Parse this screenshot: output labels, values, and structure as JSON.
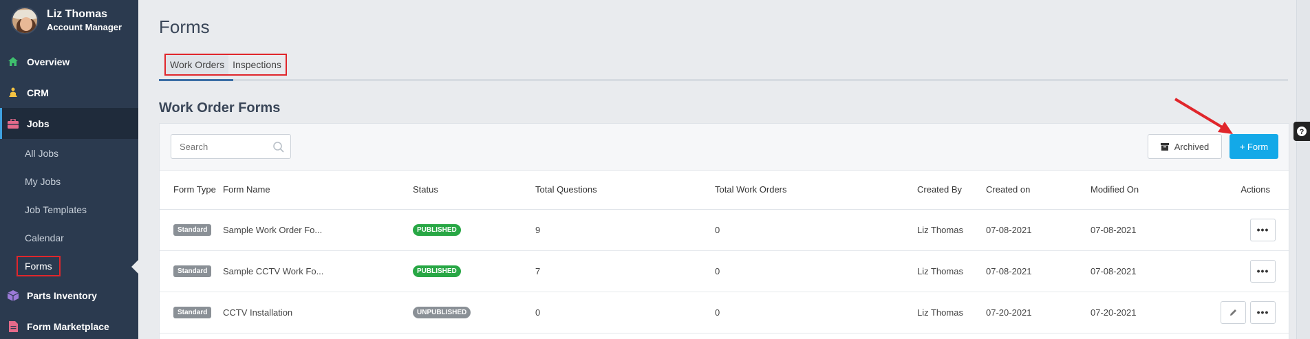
{
  "user": {
    "name": "Liz Thomas",
    "role": "Account Manager"
  },
  "nav": {
    "overview": "Overview",
    "crm": "CRM",
    "jobs": "Jobs",
    "sub": [
      "All Jobs",
      "My Jobs",
      "Job Templates",
      "Calendar",
      "Forms"
    ],
    "parts": "Parts Inventory",
    "marketplace": "Form Marketplace"
  },
  "page": {
    "title": "Forms"
  },
  "tabs": [
    "Work Orders",
    "Inspections"
  ],
  "section": {
    "title": "Work Order Forms"
  },
  "toolbar": {
    "search_placeholder": "Search",
    "archived_label": "Archived",
    "add_form_label": "+ Form"
  },
  "table": {
    "headers": [
      "Form Type",
      "Form Name",
      "Status",
      "Total Questions",
      "Total Work Orders",
      "Created By",
      "Created on",
      "Modified On",
      "Actions"
    ],
    "rows": [
      {
        "type": "Standard",
        "name": "Sample Work Order Fo...",
        "status": "PUBLISHED",
        "questions": "9",
        "work_orders": "0",
        "created_by": "Liz Thomas",
        "created_on": "07-08-2021",
        "modified_on": "07-08-2021"
      },
      {
        "type": "Standard",
        "name": "Sample CCTV Work Fo...",
        "status": "PUBLISHED",
        "questions": "7",
        "work_orders": "0",
        "created_by": "Liz Thomas",
        "created_on": "07-08-2021",
        "modified_on": "07-08-2021"
      },
      {
        "type": "Standard",
        "name": "CCTV Installation",
        "status": "UNPUBLISHED",
        "questions": "0",
        "work_orders": "0",
        "created_by": "Liz Thomas",
        "created_on": "07-20-2021",
        "modified_on": "07-20-2021"
      }
    ],
    "dots": "•••"
  },
  "colors": {
    "sidebar": "#2b3a4f",
    "accent": "#13a9e8",
    "published": "#28a745",
    "highlight": "#e0262b"
  }
}
